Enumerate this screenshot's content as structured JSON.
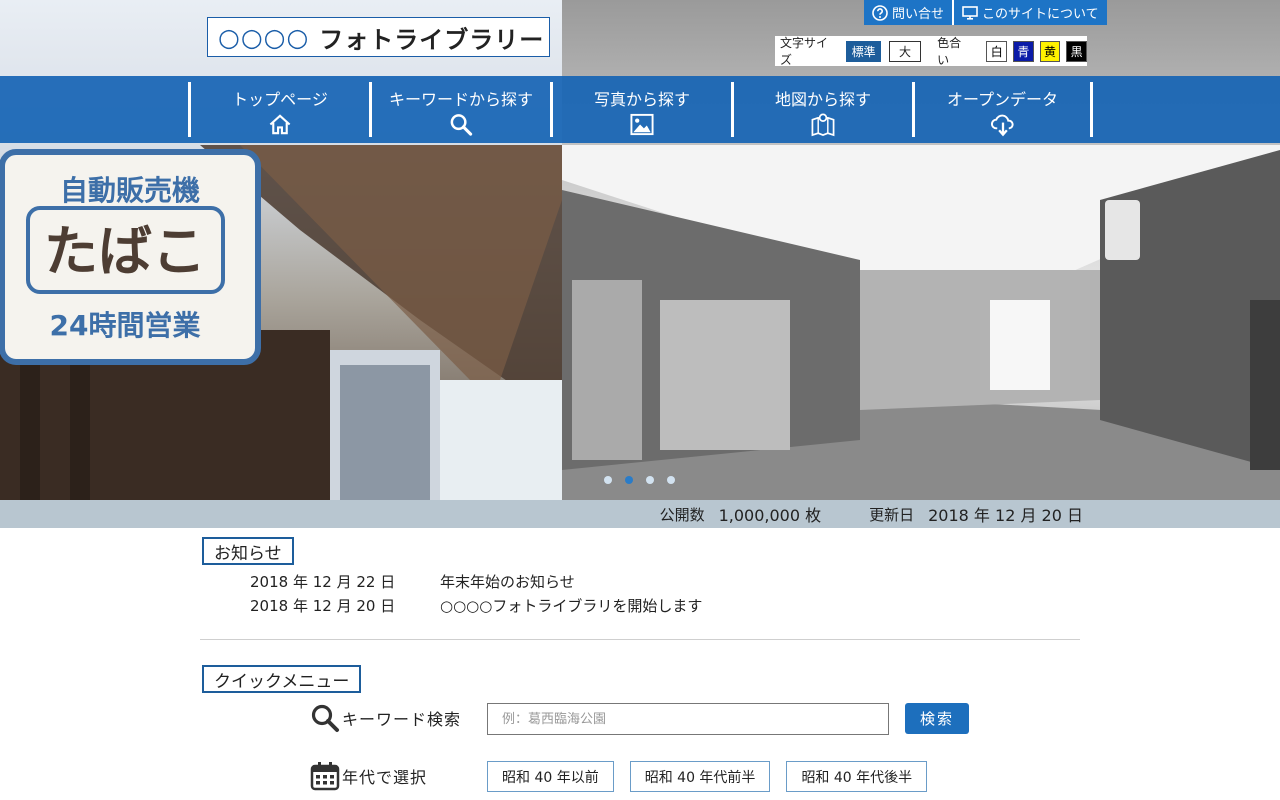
{
  "header": {
    "logo_mark": "○○○○",
    "logo_text": "フォトライブラリー",
    "links": [
      {
        "label": "問い合せ",
        "icon": "question-circle-icon"
      },
      {
        "label": "このサイトについて",
        "icon": "monitor-icon"
      }
    ],
    "settings": {
      "font_size_label": "文字サイズ",
      "font_standard": "標準",
      "font_large": "大",
      "color_label": "色合い",
      "colors": [
        {
          "label": "白",
          "bg": "#ffffff",
          "fg": "#000000"
        },
        {
          "label": "青",
          "bg": "#0b1ba8",
          "fg": "#ffffff"
        },
        {
          "label": "黄",
          "bg": "#fff200",
          "fg": "#000000"
        },
        {
          "label": "黒",
          "bg": "#000000",
          "fg": "#ffffff"
        }
      ]
    }
  },
  "nav": {
    "items": [
      {
        "label": "トップページ",
        "icon": "home-icon"
      },
      {
        "label": "キーワードから探す",
        "icon": "search-icon"
      },
      {
        "label": "写真から探す",
        "icon": "image-icon"
      },
      {
        "label": "地図から探す",
        "icon": "map-icon"
      },
      {
        "label": "オープンデータ",
        "icon": "cloud-download-icon"
      }
    ]
  },
  "hero": {
    "slides": 4,
    "active_slide": 2,
    "sign": {
      "top": "自動販売機",
      "main": "たばこ",
      "bottom": "24時間営業"
    }
  },
  "stats": {
    "public_label": "公開数",
    "public_value": "1,000,000 枚",
    "updated_label": "更新日",
    "updated_value": "2018 年 12 月 20 日"
  },
  "news": {
    "title": "お知らせ",
    "items": [
      {
        "date": "2018 年 12 月 22 日",
        "text": "年末年始のお知らせ"
      },
      {
        "date": "2018 年 12 月 20 日",
        "text": "○○○○フォトライブラリを開始します"
      }
    ]
  },
  "quick": {
    "title": "クイックメニュー",
    "keyword_label": "キーワード検索",
    "keyword_placeholder": "例：葛西臨海公園",
    "search_button": "検索",
    "era_label": "年代で選択",
    "eras": [
      "昭和 40 年以前",
      "昭和 40 年代前半",
      "昭和 40 年代後半"
    ]
  },
  "colors": {
    "brand": "#1d6fbd",
    "nav_bg": "#1664b4",
    "stats_bg": "#b8c6d0"
  }
}
